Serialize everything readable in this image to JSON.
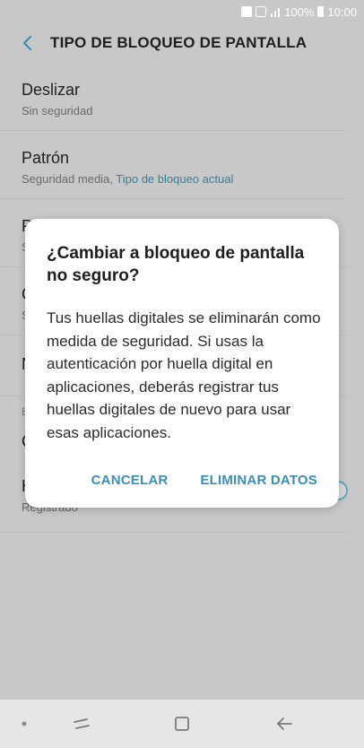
{
  "status_bar": {
    "battery_percent": "100%",
    "time": "10:00"
  },
  "header": {
    "title": "TIPO DE BLOQUEO DE PANTALLA"
  },
  "settings": {
    "rows": [
      {
        "title": "Deslizar",
        "subtitle": "Sin seguridad",
        "accent": ""
      },
      {
        "title": "Patrón",
        "subtitle": "Seguridad media, ",
        "accent": "Tipo de bloqueo actual"
      },
      {
        "title": "P",
        "subtitle": "S",
        "accent": ""
      },
      {
        "title": "C",
        "subtitle": "S",
        "accent": ""
      },
      {
        "title": "N",
        "subtitle": "",
        "accent": ""
      },
      {
        "title": "C",
        "subtitle": "",
        "accent": ""
      },
      {
        "title": "H",
        "subtitle": "Registrado",
        "accent": ""
      }
    ],
    "section_label": "B"
  },
  "dialog": {
    "title": "¿Cambiar a bloqueo de pantalla no seguro?",
    "body": "Tus huellas digitales se eliminarán como medida de seguridad. Si usas la autenticación por huella digital en aplicaciones, deberás registrar tus huellas digitales de nuevo para usar esas aplicaciones.",
    "cancel_label": "CANCELAR",
    "confirm_label": "ELIMINAR DATOS"
  },
  "colors": {
    "accent": "#3a8fb3",
    "toggle_on": "#5aa6c4"
  },
  "icons": {
    "back": "back-arrow-icon",
    "nav_dot": "nav-dot-icon",
    "recents": "recents-icon",
    "home": "home-icon",
    "nav_back": "nav-back-icon"
  }
}
